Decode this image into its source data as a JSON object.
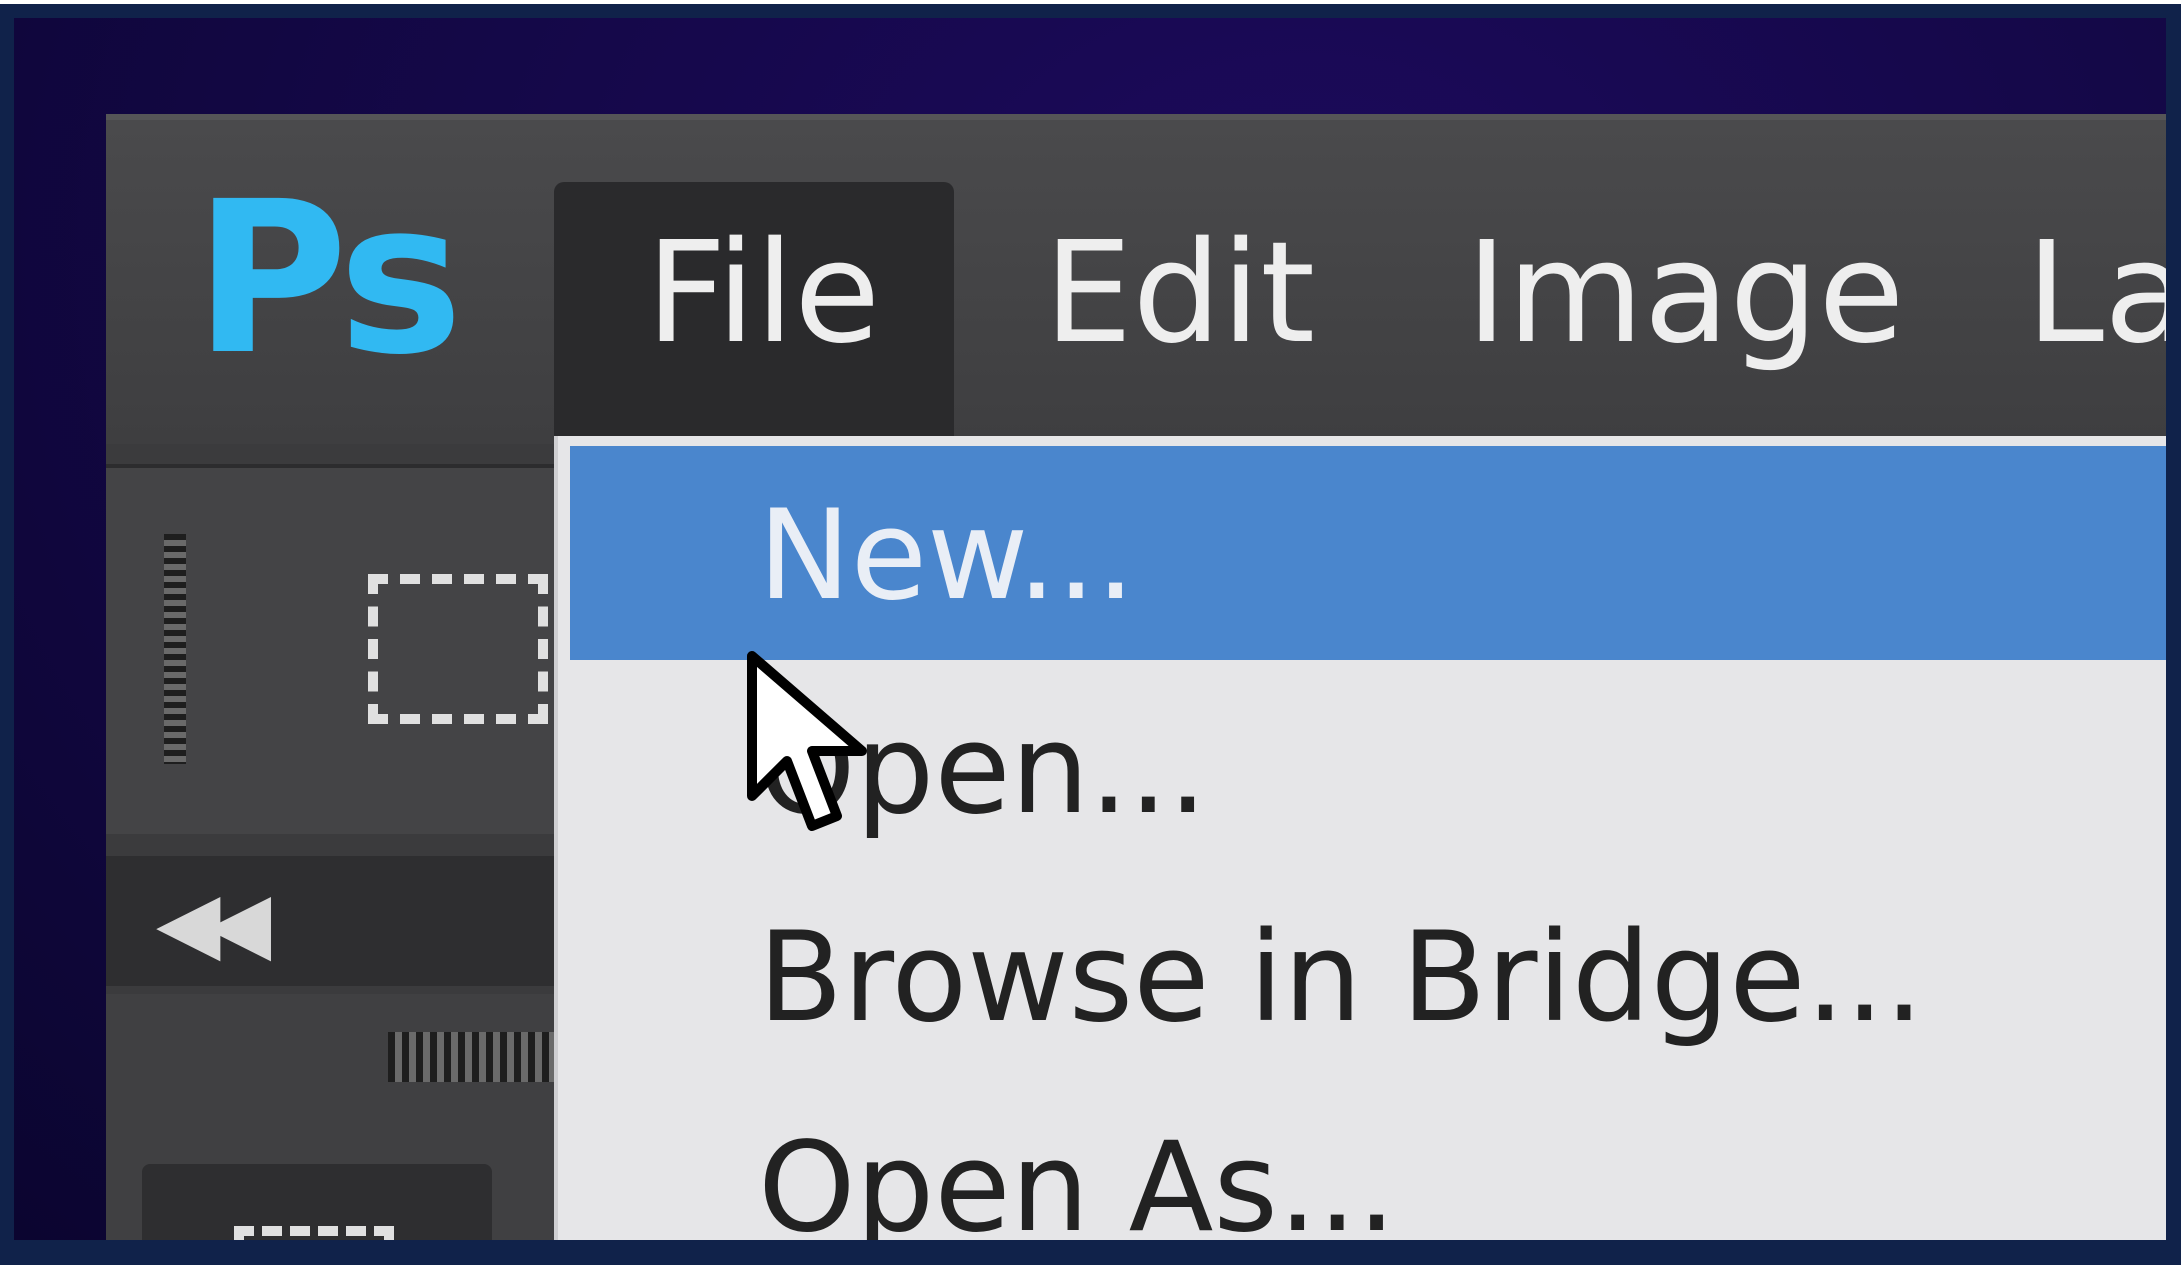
{
  "app": {
    "logo_text": "Ps",
    "brand_color": "#31b9f2"
  },
  "menubar": {
    "items": [
      {
        "label": "File",
        "active": true
      },
      {
        "label": "Edit"
      },
      {
        "label": "Image"
      },
      {
        "label": "La"
      }
    ]
  },
  "file_menu": {
    "items": [
      {
        "label": "New...",
        "highlighted": true
      },
      {
        "label": "Open..."
      },
      {
        "label": "Browse in  Bridge..."
      },
      {
        "label": "Open As..."
      }
    ],
    "highlight_color": "#4a86cd"
  },
  "toolbar": {
    "icons": [
      "rectangular-marquee-icon",
      "collapse-panel-icon"
    ],
    "collapse_glyph": "◀◀"
  }
}
